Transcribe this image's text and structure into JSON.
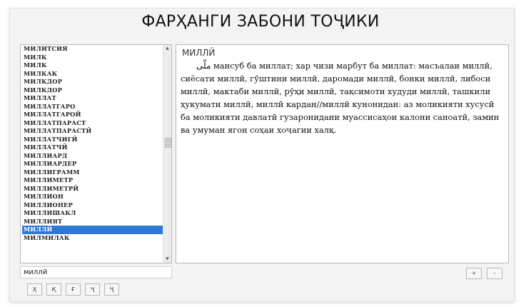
{
  "app": {
    "title": "ФАРҲАНГИ ЗАБОНИ ТОҶИКИ"
  },
  "word_list": {
    "items": [
      "МИЛИТСИЯ",
      "МИЛК",
      "МИЛК",
      "МИЛКАК",
      "МИЛКДОР",
      "МИЛКДОР",
      "МИЛЛАТ",
      "МИЛЛАТГАРО",
      "МИЛЛАТГАРОЙ",
      "МИЛЛАТПАРАСТ",
      "МИЛЛАТПАРАСТӢ",
      "МИЛЛАТЧИГӢ",
      "МИЛЛАТЧӢ",
      "МИЛЛИАРД",
      "МИЛЛИАРДЕР",
      "МИЛЛИГРАММ",
      "МИЛЛИМЕТР",
      "МИЛЛИМЕТРӢ",
      "МИЛЛИОН",
      "МИЛЛИОНЕР",
      "МИЛЛИШАКЛ",
      "МИЛЛИЯТ",
      "МИЛЛӢ",
      "МИЛМИЛАК"
    ],
    "selected": "МИЛЛӢ"
  },
  "definition": {
    "headword": "МИЛЛӢ",
    "arabic": "ملّی",
    "text": "мансуб ба миллат; хар чизи марбут ба миллат: масъалаи миллӣ, сиёсати миллӣ, гӯштини миллӣ, даромади миллӣ, бонки миллӣ, либоси миллӣ, мактаби миллӣ, рӯҳи миллӣ, тақсимоти худуди миллӣ, ташкили ҳукумати миллӣ, миллӣ кардан//миллӣ кунонидан: аз моликияти хусусӣ ба моликияти давлатӣ гузаронидани муассисаҳои калони саноатӣ, замин ва умуман ягон соҳаи хоҷагии халқ."
  },
  "search": {
    "value": "миллӣ"
  },
  "letter_buttons": [
    "Ҳ",
    "Қ",
    "Ғ",
    "Ҷ",
    "Ҷ"
  ],
  "zoom": {
    "in": "+",
    "out": "-"
  },
  "scrollbar": {
    "up": "▲",
    "down": "▼"
  },
  "colors": {
    "selection": "#2f78d6",
    "panel_bg": "#f3f3f3"
  }
}
